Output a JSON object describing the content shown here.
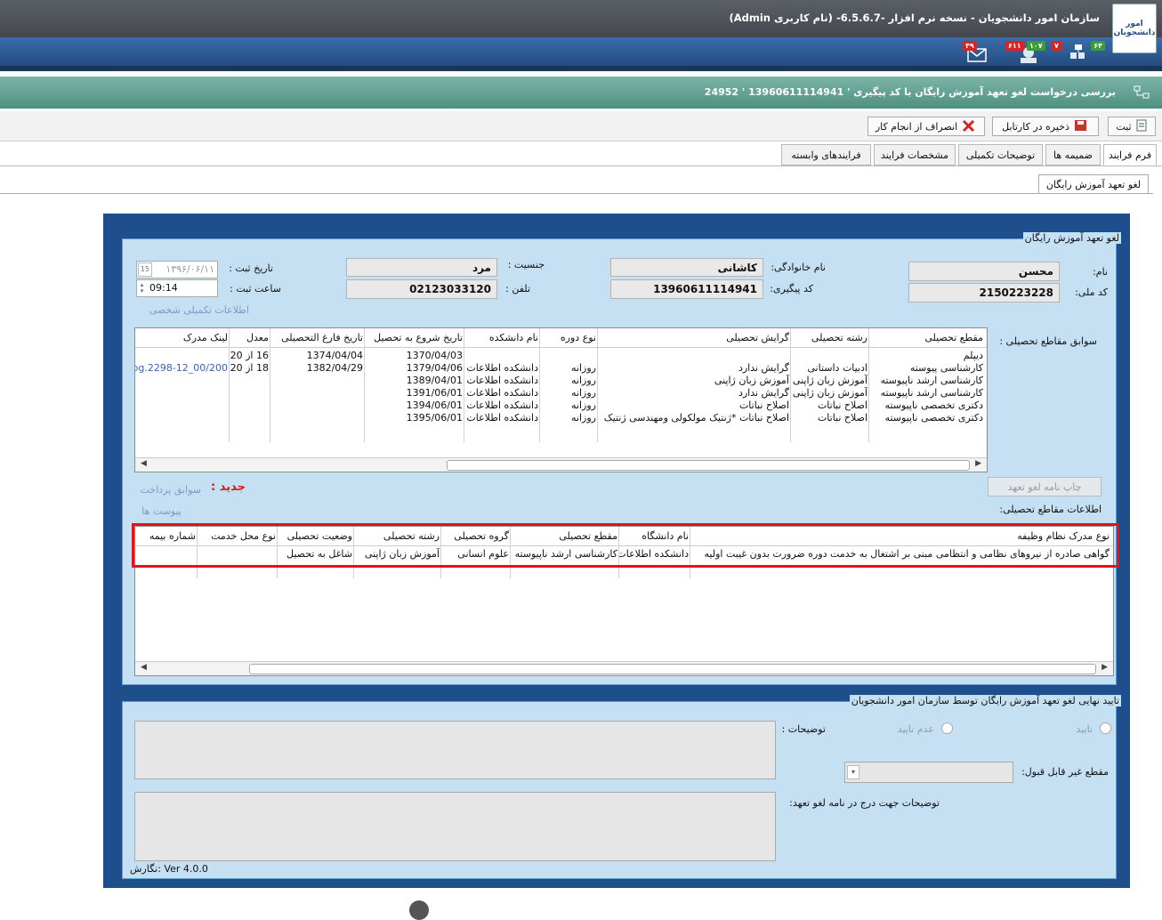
{
  "app": {
    "title": "سازمان امور دانشجویان - نسخه نرم افزار -6.5.6.7- (نام کاربری Admin)",
    "logo_text": "امور دانشجویان"
  },
  "notify": {
    "a": "۶۴",
    "b": "۷",
    "c": "۱۰۷",
    "d": "۶۱۱",
    "e": "۴۹"
  },
  "header": {
    "title": "بررسی درخواست لغو تعهد آموزش رایگان با کد پیگیری ' 13960611114941 ' 24952"
  },
  "toolbar": {
    "submit": "ثبت",
    "save": "ذخیره در کارتابل",
    "cancel": "انصراف از انجام کار"
  },
  "tabs": [
    "فرم فرایند",
    "ضمیمه ها",
    "توضیحات تکمیلی",
    "مشخصات فرایند",
    "فرایندهای وابسته"
  ],
  "subtab": "لغو تعهد آموزش رایگان",
  "form": {
    "legend": "لغو تعهد آموزش رایگان",
    "name_label": "نام:",
    "name": "محسن",
    "national_id_label": "کد ملی:",
    "national_id": "2150223228",
    "family_label": "نام خانوادگی:",
    "family": "کاشانی",
    "tracking_label": "کد پیگیری:",
    "tracking": "13960611114941",
    "gender_label": "جنسیت :",
    "gender": "مرد",
    "phone_label": "تلفن :",
    "phone": "02123033120",
    "reg_date_label": "تاریخ ثبت :",
    "reg_date": "۱۳۹۶/۰۶/۱۱",
    "cal": "15",
    "reg_time_label": "ساعت ثبت :",
    "reg_time": "09:14",
    "extra_link": "اطلاعات تکمیلی شخصی",
    "history_label": "سوابق مقاطع تحصیلی :",
    "edu_cols": [
      "مقطع تحصیلی",
      "رشته تحصیلی",
      "گرایش تحصیلی",
      "نوع دوره",
      "نام دانشکده",
      "تاریخ شروع به تحصیل",
      "تاریخ فارغ التحصیلی",
      "معدل",
      "لینک مدرک"
    ],
    "edu_rows": [
      [
        "دیپلم",
        "",
        "",
        "",
        "",
        "1370/04/03",
        "1374/04/04",
        "16 از 20",
        ""
      ],
      [
        "کارشناسی پیوسته",
        "ادبیات داستانی",
        "گرایش ندارد",
        "روزانه",
        "دانشکده اطلاعات",
        "1379/04/06",
        "1382/04/29",
        "18 از 20",
        "00/200_2298-12.jpg"
      ],
      [
        "کارشناسی ارشد ناپیوسته",
        "آموزش زبان ژاپنی",
        "آموزش زبان ژاپنی",
        "روزانه",
        "دانشکده اطلاعات",
        "1389/04/01",
        "",
        "",
        ""
      ],
      [
        "کارشناسی ارشد ناپیوسته",
        "آموزش زبان ژاپنی",
        "گرایش ندارد",
        "روزانه",
        "دانشکده اطلاعات",
        "1391/06/01",
        "",
        "",
        ""
      ],
      [
        "دکتری تخصصی ناپیوسته",
        "اصلاح نباتات",
        "اصلاح نباتات",
        "روزانه",
        "دانشکده اطلاعات",
        "1394/06/01",
        "",
        "",
        ""
      ],
      [
        "دکتری تخصصی ناپیوسته",
        "اصلاح نباتات",
        "اصلاح نباتات *ژنتیک مولکولی ومهندسی ژنتیک",
        "روزانه",
        "دانشکده اطلاعات",
        "1395/06/01",
        "",
        "",
        ""
      ]
    ],
    "print_btn": "چاپ نامه لغو تعهد",
    "new_label": "جدید :",
    "payment_link": "سوابق پرداخت",
    "attach_link": "پیوست ها",
    "info_label": "اطلاعات مقاطع تحصیلی:",
    "mil_cols": [
      "نوع مدرک نظام وظیفه",
      "نام دانشگاه",
      "مقطع تحصیلی",
      "گروه تحصیلی",
      "رشته تحصیلی",
      "وضعیت تحصیلی",
      "نوع محل خدمت",
      "شماره بیمه"
    ],
    "mil_row": [
      "گواهی صادره از نیروهای نظامی و انتظامی مبنی بر اشتغال به خدمت دوره ضرورت بدون غیبت اولیه",
      "دانشکده اطلاعات",
      "کارشناسی ارشد ناپیوسته",
      "علوم انسانی",
      "آموزش زبان ژاپنی",
      "شاغل به تحصیل",
      "",
      ""
    ]
  },
  "approval": {
    "legend": "تایید نهایی لغو تعهد آموزش رایگان توسط سازمان امور دانشجویان",
    "approve": "تایید",
    "reject": "عدم تایید",
    "desc_label": "توضیحات :",
    "unacceptable_label": "مقطع غیر قابل قبول:",
    "letter_label": "توضیحات جهت درج در نامه لغو تعهد:"
  },
  "footer": {
    "version": "نگارش: Ver 4.0.0"
  }
}
